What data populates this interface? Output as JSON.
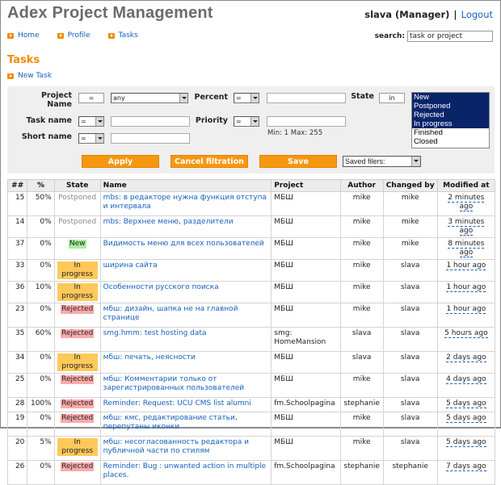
{
  "header": {
    "app_title": "Adex Project Management",
    "user": "slava (Manager)",
    "separator": "|",
    "logout_label": "Logout"
  },
  "nav": {
    "items": [
      {
        "label": "Home",
        "icon": "arrow-right-icon"
      },
      {
        "label": "Profile",
        "icon": "arrow-right-icon"
      },
      {
        "label": "Tasks",
        "icon": "arrow-right-icon"
      }
    ]
  },
  "search": {
    "label": "search:",
    "value": "task or project"
  },
  "page": {
    "title": "Tasks",
    "new_task_label": "New Task"
  },
  "filter": {
    "project_name_label": "Project Name",
    "project_op": "=",
    "project_value": "any",
    "task_name_label": "Task name",
    "task_name_op": "=",
    "task_name_value": "",
    "short_name_label": "Short name",
    "short_name_op": "=",
    "short_name_value": "",
    "percent_label": "Percent",
    "percent_op": "=",
    "percent_value": "",
    "priority_label": "Priority",
    "priority_op": "=",
    "priority_value": "",
    "priority_hint": "Min: 1 Max: 255",
    "state_label": "State",
    "state_op": "in",
    "state_options": [
      {
        "label": "New",
        "selected": true
      },
      {
        "label": "Postponed",
        "selected": true
      },
      {
        "label": "Rejected",
        "selected": true
      },
      {
        "label": "In progress",
        "selected": true
      },
      {
        "label": "Finished",
        "selected": false
      },
      {
        "label": "Closed",
        "selected": false
      }
    ],
    "apply_label": "Apply",
    "cancel_label": "Cancel filtration",
    "save_label": "Save",
    "saved_filters_label": "Saved filers:"
  },
  "colors": {
    "accent": "#f28c00",
    "link": "#1560bd",
    "state_new": "#a8eea0",
    "state_inprogress": "#ffc95a",
    "state_rejected": "#ffaaaa",
    "state_postponed_text": "#8a8a8a",
    "list_selected": "#0a246a"
  },
  "table": {
    "headers": [
      "##",
      "%",
      "State",
      "Name",
      "Project",
      "Author",
      "Changed by",
      "Modified at"
    ],
    "rows": [
      {
        "id": "15",
        "percent": "50%",
        "state": "Postponed",
        "name": "mbs: в редакторе нужна функция отступа и интервала",
        "project": "МБШ",
        "author": "mike",
        "changed_by": "mike",
        "modified": "2 minutes ago"
      },
      {
        "id": "14",
        "percent": "0%",
        "state": "Postponed",
        "name": "mbs: Верхнее меню, разделители",
        "project": "МБШ",
        "author": "mike",
        "changed_by": "mike",
        "modified": "3 minutes ago"
      },
      {
        "id": "37",
        "percent": "0%",
        "state": "New",
        "name": "Видимость меню для всех пользователей",
        "project": "МБШ",
        "author": "mike",
        "changed_by": "mike",
        "modified": "8 minutes ago"
      },
      {
        "id": "33",
        "percent": "0%",
        "state": "In progress",
        "name": "ширина сайта",
        "project": "МБШ",
        "author": "mike",
        "changed_by": "slava",
        "modified": "1 hour ago"
      },
      {
        "id": "36",
        "percent": "10%",
        "state": "In progress",
        "name": "Особенности русского поиска",
        "project": "МБШ",
        "author": "mike",
        "changed_by": "slava",
        "modified": "1 hour ago"
      },
      {
        "id": "23",
        "percent": "0%",
        "state": "Rejected",
        "name": "мбш: дизайн, шапка не на главной странице",
        "project": "МБШ",
        "author": "mike",
        "changed_by": "slava",
        "modified": "1 hour ago"
      },
      {
        "id": "35",
        "percent": "60%",
        "state": "Rejected",
        "name": "smg.hmm: test hosting data",
        "project": "smg: HomeMansion",
        "author": "slava",
        "changed_by": "slava",
        "modified": "5 hours ago"
      },
      {
        "id": "34",
        "percent": "0%",
        "state": "In progress",
        "name": "мбш: печать, неясности",
        "project": "МБШ",
        "author": "slava",
        "changed_by": "slava",
        "modified": "2 days ago"
      },
      {
        "id": "25",
        "percent": "0%",
        "state": "Rejected",
        "name": "мбш: Комментарии только от зарегистрированных пользователей",
        "project": "МБШ",
        "author": "mike",
        "changed_by": "slava",
        "modified": "4 days ago"
      },
      {
        "id": "28",
        "percent": "100%",
        "state": "Rejected",
        "name": "Reminder: Request: UCU CMS list alumni",
        "project": "fm.Schoolpagina",
        "author": "stephanie",
        "changed_by": "slava",
        "modified": "5 days ago"
      },
      {
        "id": "19",
        "percent": "0%",
        "state": "Rejected",
        "name": "мбш: кмс, редактирование статьи, перепутаны иконки",
        "project": "МБШ",
        "author": "mike",
        "changed_by": "slava",
        "modified": "5 days ago"
      },
      {
        "id": "20",
        "percent": "5%",
        "state": "In progress",
        "name": "мбш: несогласованность редактора и публичной части по стилям",
        "project": "МБШ",
        "author": "mike",
        "changed_by": "slava",
        "modified": "5 days ago"
      },
      {
        "id": "26",
        "percent": "0%",
        "state": "Rejected",
        "name": "Reminder: Bug : unwanted action in multiple places.",
        "project": "fm.Schoolpagina",
        "author": "stephanie",
        "changed_by": "stephanie",
        "modified": "7 days ago"
      }
    ]
  }
}
